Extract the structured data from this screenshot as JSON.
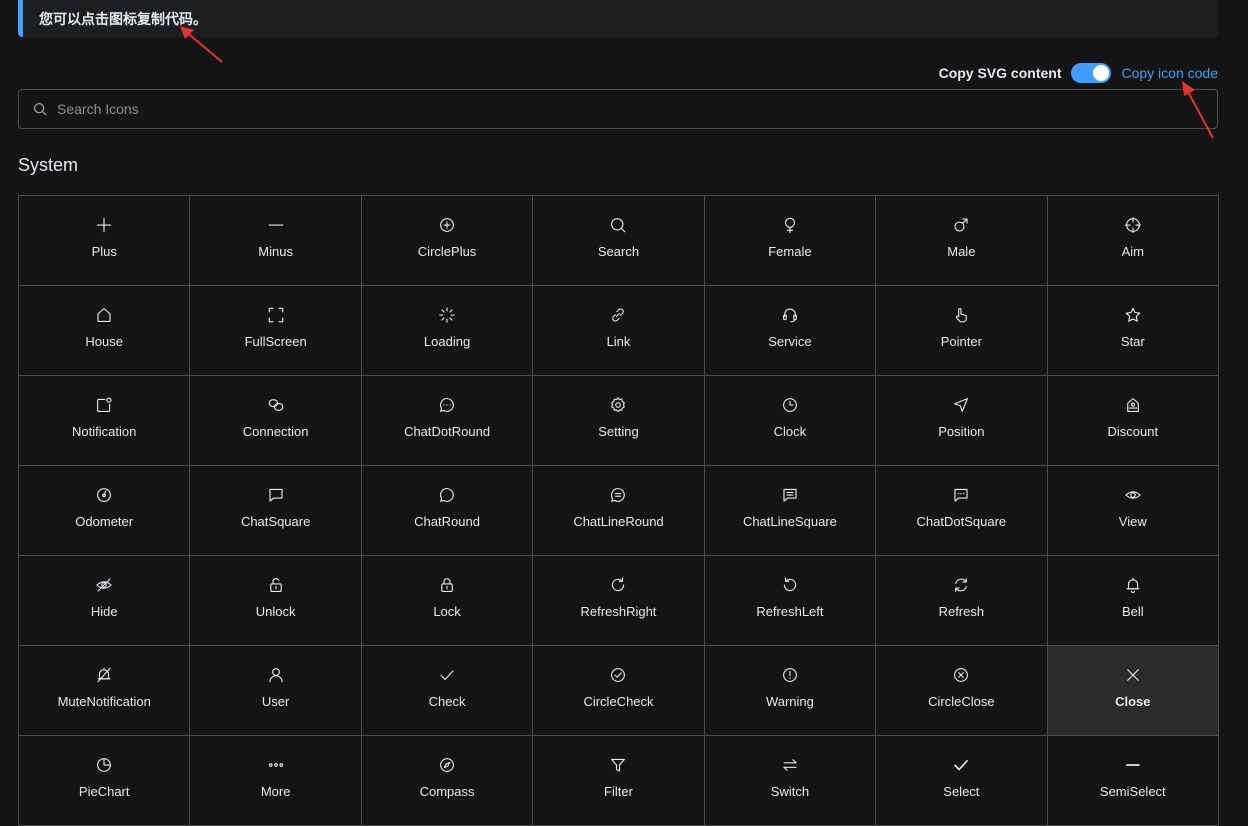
{
  "tip": {
    "text": "您可以点击图标复制代码。"
  },
  "copy": {
    "svg_label": "Copy SVG content",
    "svg_enabled": true,
    "link_label": "Copy icon code"
  },
  "search": {
    "placeholder": "Search Icons",
    "value": ""
  },
  "section": {
    "title": "System"
  },
  "icons": [
    {
      "name": "Plus",
      "icon": "plus"
    },
    {
      "name": "Minus",
      "icon": "minus"
    },
    {
      "name": "CirclePlus",
      "icon": "circle-plus"
    },
    {
      "name": "Search",
      "icon": "search"
    },
    {
      "name": "Female",
      "icon": "female"
    },
    {
      "name": "Male",
      "icon": "male"
    },
    {
      "name": "Aim",
      "icon": "aim"
    },
    {
      "name": "House",
      "icon": "house"
    },
    {
      "name": "FullScreen",
      "icon": "fullscreen"
    },
    {
      "name": "Loading",
      "icon": "loading"
    },
    {
      "name": "Link",
      "icon": "link"
    },
    {
      "name": "Service",
      "icon": "service"
    },
    {
      "name": "Pointer",
      "icon": "pointer"
    },
    {
      "name": "Star",
      "icon": "star"
    },
    {
      "name": "Notification",
      "icon": "notification"
    },
    {
      "name": "Connection",
      "icon": "connection"
    },
    {
      "name": "ChatDotRound",
      "icon": "chat-dot-round"
    },
    {
      "name": "Setting",
      "icon": "setting"
    },
    {
      "name": "Clock",
      "icon": "clock"
    },
    {
      "name": "Position",
      "icon": "position"
    },
    {
      "name": "Discount",
      "icon": "discount"
    },
    {
      "name": "Odometer",
      "icon": "odometer"
    },
    {
      "name": "ChatSquare",
      "icon": "chat-square"
    },
    {
      "name": "ChatRound",
      "icon": "chat-round"
    },
    {
      "name": "ChatLineRound",
      "icon": "chat-line-round"
    },
    {
      "name": "ChatLineSquare",
      "icon": "chat-line-square"
    },
    {
      "name": "ChatDotSquare",
      "icon": "chat-dot-square"
    },
    {
      "name": "View",
      "icon": "view"
    },
    {
      "name": "Hide",
      "icon": "hide"
    },
    {
      "name": "Unlock",
      "icon": "unlock"
    },
    {
      "name": "Lock",
      "icon": "lock"
    },
    {
      "name": "RefreshRight",
      "icon": "refresh-right"
    },
    {
      "name": "RefreshLeft",
      "icon": "refresh-left"
    },
    {
      "name": "Refresh",
      "icon": "refresh"
    },
    {
      "name": "Bell",
      "icon": "bell"
    },
    {
      "name": "MuteNotification",
      "icon": "mute-notification"
    },
    {
      "name": "User",
      "icon": "user"
    },
    {
      "name": "Check",
      "icon": "check"
    },
    {
      "name": "CircleCheck",
      "icon": "circle-check"
    },
    {
      "name": "Warning",
      "icon": "warning"
    },
    {
      "name": "CircleClose",
      "icon": "circle-close"
    },
    {
      "name": "Close",
      "icon": "close",
      "active": true
    },
    {
      "name": "PieChart",
      "icon": "pie-chart"
    },
    {
      "name": "More",
      "icon": "more"
    },
    {
      "name": "Compass",
      "icon": "compass"
    },
    {
      "name": "Filter",
      "icon": "filter"
    },
    {
      "name": "Switch",
      "icon": "switch"
    },
    {
      "name": "Select",
      "icon": "select"
    },
    {
      "name": "SemiSelect",
      "icon": "semi-select"
    }
  ],
  "colors": {
    "accent": "#409eff",
    "background": "#141414",
    "border": "#4c4d4f",
    "annotation": "#e5322d"
  }
}
